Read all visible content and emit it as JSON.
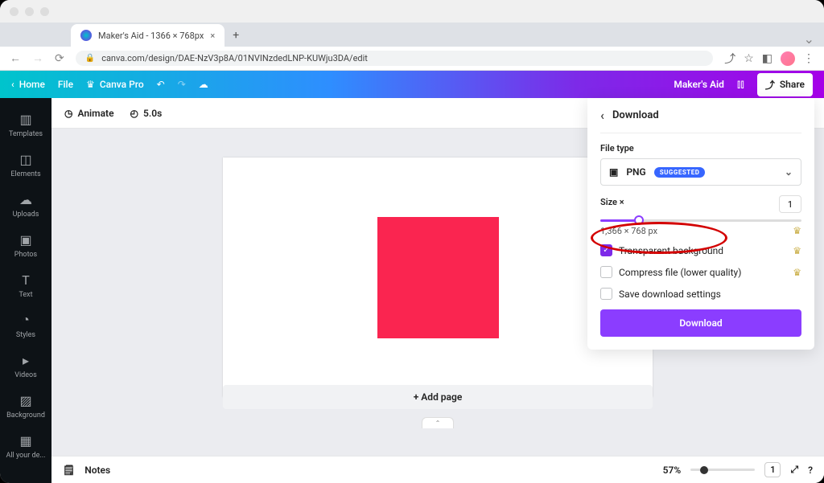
{
  "browser": {
    "tab_title": "Maker's Aid - 1366 × 768px",
    "url": "canva.com/design/DAE-NzV3p8A/01NVINzdedLNP-KUWju3DA/edit"
  },
  "header": {
    "home": "Home",
    "file": "File",
    "canva_pro": "Canva Pro",
    "doc_title": "Maker's Aid",
    "share": "Share"
  },
  "sidebar": {
    "items": [
      {
        "label": "Templates"
      },
      {
        "label": "Elements"
      },
      {
        "label": "Uploads"
      },
      {
        "label": "Photos"
      },
      {
        "label": "Text"
      },
      {
        "label": "Styles"
      },
      {
        "label": "Videos"
      },
      {
        "label": "Background"
      },
      {
        "label": "All your de..."
      }
    ]
  },
  "toolbar": {
    "animate": "Animate",
    "timer": "5.0s"
  },
  "canvas": {
    "add_page": "+ Add page"
  },
  "bottom": {
    "notes": "Notes",
    "zoom_pct": "57%",
    "page_indicator": "1"
  },
  "download": {
    "title": "Download",
    "file_type_label": "File type",
    "file_type_value": "PNG",
    "suggested": "SUGGESTED",
    "size_label": "Size ×",
    "size_value": "1",
    "dimensions": "1,366 × 768 px",
    "option_transparent": "Transparent background",
    "option_compress": "Compress file (lower quality)",
    "option_save": "Save download settings",
    "button": "Download"
  }
}
